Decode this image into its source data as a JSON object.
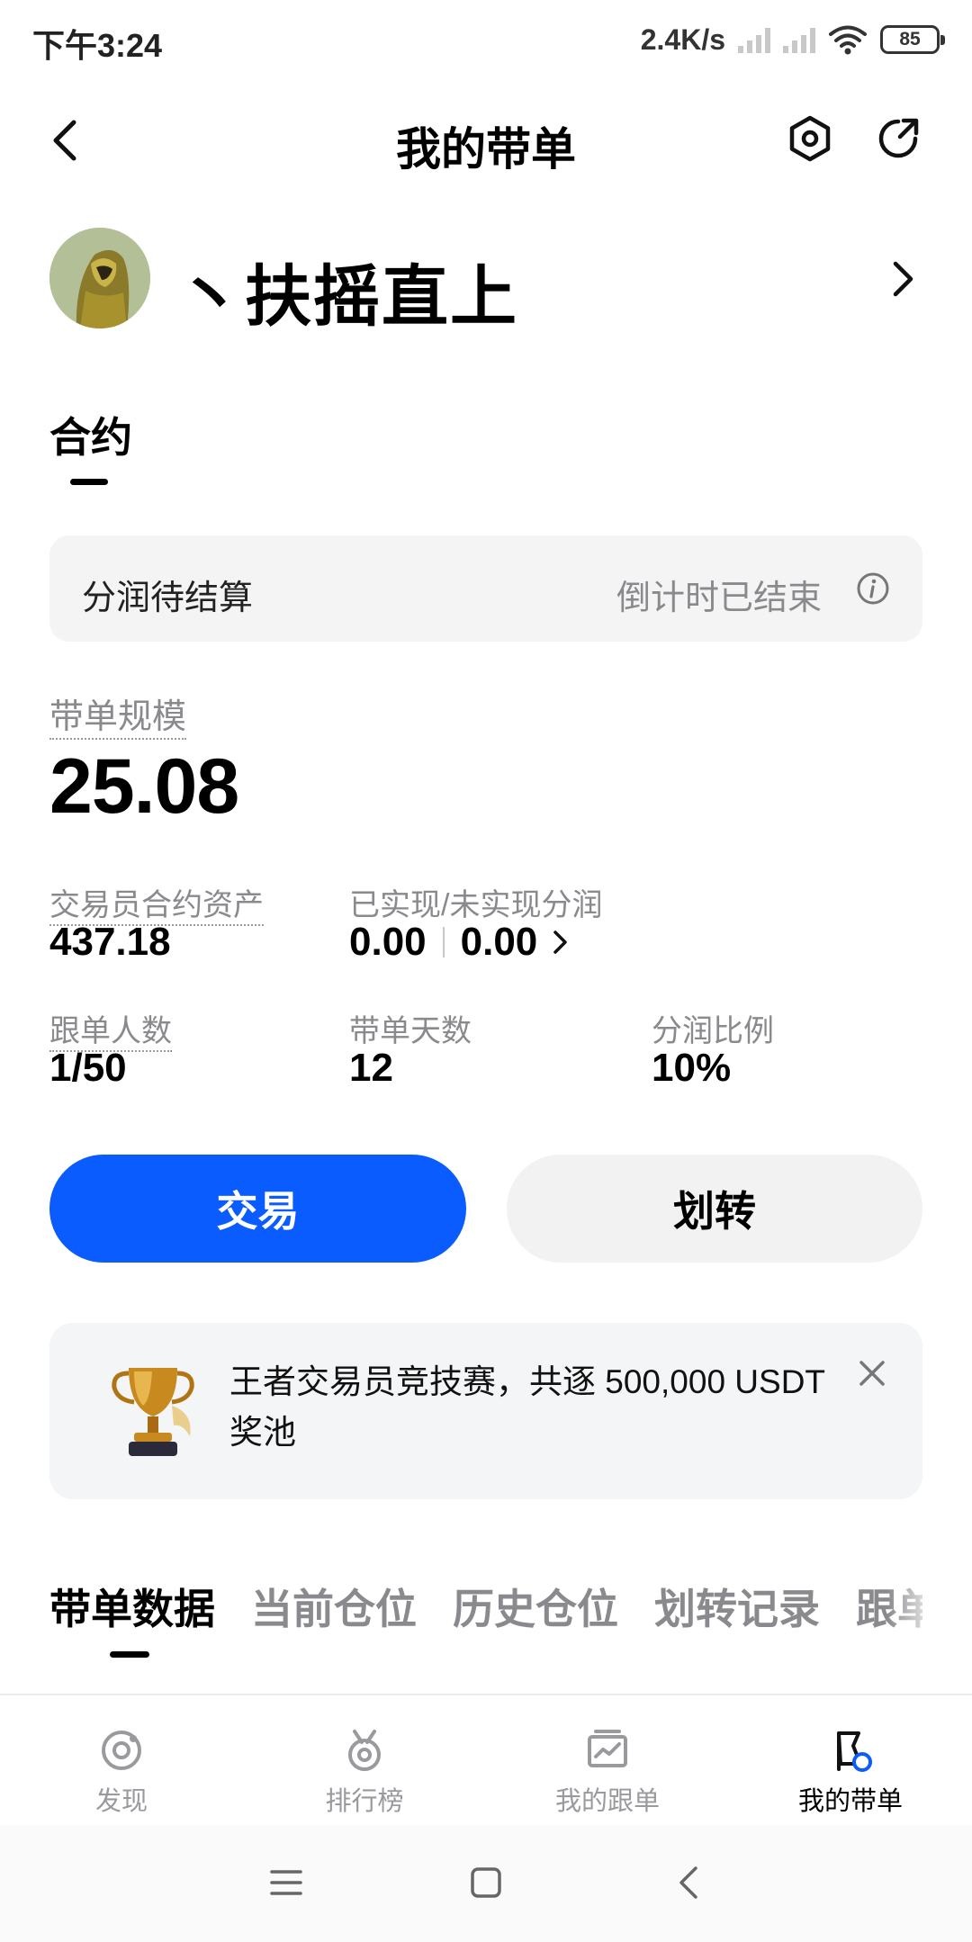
{
  "status_bar": {
    "time": "下午3:24",
    "net_speed": "2.4K/s",
    "battery": "85"
  },
  "header": {
    "title": "我的带单"
  },
  "profile": {
    "name": "丶扶摇直上"
  },
  "tabs": {
    "contract": "合约"
  },
  "profit_card": {
    "label": "分润待结算",
    "status": "倒计时已结束"
  },
  "stats": {
    "scale_label": "带单规模",
    "scale_value": "25.08",
    "asset_label": "交易员合约资产",
    "asset_value": "437.18",
    "pnl_label": "已实现/未实现分润",
    "realized": "0.00",
    "unrealized": "0.00",
    "followers_label": "跟单人数",
    "followers_value": "1/50",
    "days_label": "带单天数",
    "days_value": "12",
    "ratio_label": "分润比例",
    "ratio_value": "10%"
  },
  "actions": {
    "trade": "交易",
    "transfer": "划转"
  },
  "banner": {
    "text": "王者交易员竞技赛，共逐 500,000 USDT 奖池"
  },
  "section_tabs": [
    "带单数据",
    "当前仓位",
    "历史仓位",
    "划转记录",
    "跟单"
  ],
  "bottom_nav": [
    "发现",
    "排行榜",
    "我的跟单",
    "我的带单"
  ],
  "colors": {
    "accent": "#0a5cff",
    "muted_text": "#8a8a8e",
    "card_bg": "#f4f4f5"
  }
}
